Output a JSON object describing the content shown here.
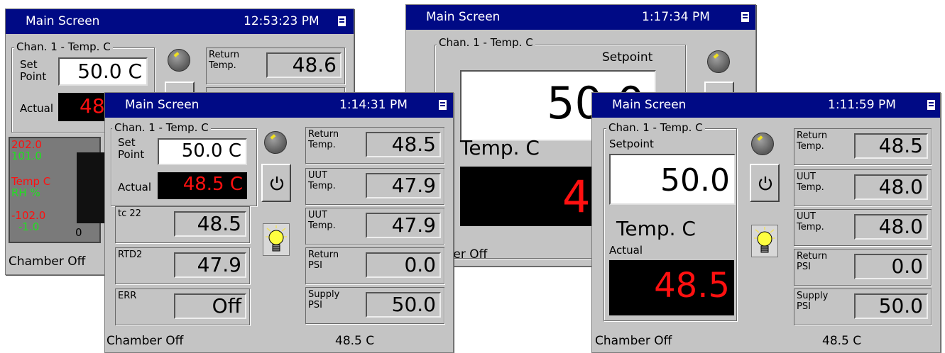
{
  "w1": {
    "title": "Main Screen",
    "time": "12:53:23 PM",
    "group_label": "Chan. 1 - Temp. C",
    "setpoint_label": "Set Point",
    "setpoint_value": "50.0 C",
    "actual_label": "Actual",
    "actual_value": "48",
    "return_label": "Return Temp.",
    "return_value": "48.6",
    "chart": {
      "y_top": "202.0",
      "y_top2": "101.0",
      "series1": "Temp C",
      "series2": "RH %",
      "y_bot": "-102.0",
      "y_bot2": "-1.0",
      "x0": "0"
    },
    "status": "Chamber Off"
  },
  "w2": {
    "title": "Main Screen",
    "time": "1:17:34 PM",
    "group_label": "Chan. 1 - Temp. C",
    "setpoint_label": "Setpoint",
    "setpoint_value": "50.0",
    "unit_label": "Temp. C",
    "actual_value": "48",
    "status": "Chamber Off"
  },
  "w3": {
    "title": "Main Screen",
    "time": "1:14:31 PM",
    "group_label": "Chan. 1 - Temp. C",
    "setpoint_label": "Set Point",
    "setpoint_value": "50.0 C",
    "actual_label": "Actual",
    "actual_value": "48.5 C",
    "left_tiles": [
      {
        "label": "tc 22",
        "value": "48.5"
      },
      {
        "label": "RTD2",
        "value": "47.9"
      },
      {
        "label": "ERR",
        "value": "Off"
      }
    ],
    "right_tiles": [
      {
        "label": "Return Temp.",
        "value": "48.5"
      },
      {
        "label": "UUT Temp.",
        "value": "47.9"
      },
      {
        "label": "UUT Temp.",
        "value": "47.9"
      },
      {
        "label": "Return PSI",
        "value": "0.0"
      },
      {
        "label": "Supply PSI",
        "value": "50.0"
      }
    ],
    "status": "Chamber Off",
    "status_temp": "48.5 C"
  },
  "w4": {
    "title": "Main Screen",
    "time": "1:11:59 PM",
    "group_label": "Chan. 1 - Temp. C",
    "setpoint_label": "Setpoint",
    "setpoint_value": "50.0",
    "unit_label": "Temp. C",
    "actual_label": "Actual",
    "actual_value": "48.5",
    "right_tiles": [
      {
        "label": "Return Temp.",
        "value": "48.5"
      },
      {
        "label": "UUT Temp.",
        "value": "48.0"
      },
      {
        "label": "UUT Temp.",
        "value": "48.0"
      },
      {
        "label": "Return PSI",
        "value": "0.0"
      },
      {
        "label": "Supply PSI",
        "value": "50.0"
      }
    ],
    "status": "Chamber Off",
    "status_temp": "48.5 C"
  },
  "colors": {
    "titlebar": "#000a85",
    "panel": "#c4c4c4",
    "alarm_text": "#ff1010",
    "trend_green": "#20e020"
  }
}
